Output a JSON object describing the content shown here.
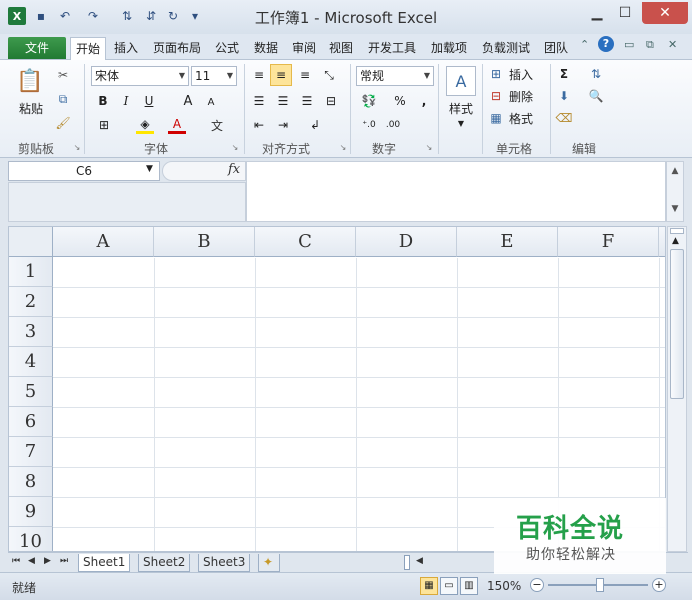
{
  "window": {
    "title": "工作簿1 - Microsoft Excel",
    "minimize": "▁",
    "maximize": "☐",
    "close": "✕"
  },
  "quick_access": [
    "💾",
    "↶",
    "↷",
    "⋮",
    "▾"
  ],
  "ribbon_tabs": [
    "文件",
    "开始",
    "插入",
    "页面布局",
    "公式",
    "数据",
    "审阅",
    "视图",
    "开发工具",
    "加载项",
    "负载测试",
    "团队"
  ],
  "ribbon": {
    "clipboard": {
      "paste": "粘贴",
      "label": "剪贴板"
    },
    "font": {
      "name": "宋体",
      "size": "11",
      "bold": "B",
      "italic": "I",
      "underline": "U",
      "grow": "A",
      "shrink": "A",
      "label": "字体"
    },
    "alignment": {
      "label": "对齐方式"
    },
    "number": {
      "format": "常规",
      "percent": "%",
      "comma": ",",
      "label": "数字"
    },
    "styles": {
      "label": "样式"
    },
    "cells": {
      "insert": "插入",
      "delete": "删除",
      "format": "格式",
      "label": "单元格"
    },
    "editing": {
      "sum": "Σ",
      "label": "编辑"
    }
  },
  "formula_bar": {
    "name_box": "C6",
    "fx": "fx",
    "value": ""
  },
  "grid": {
    "columns": [
      "A",
      "B",
      "C",
      "D",
      "E",
      "F"
    ],
    "rows": [
      "1",
      "2",
      "3",
      "4",
      "5",
      "6",
      "7",
      "8",
      "9",
      "10"
    ]
  },
  "sheets": [
    "Sheet1",
    "Sheet2",
    "Sheet3"
  ],
  "status": {
    "text": "就绪",
    "zoom": "150%"
  },
  "watermark": {
    "title": "百科全说",
    "subtitle": "助你轻松解决"
  },
  "colors": {
    "file_tab": "#217a33",
    "watermark": "#25a04a",
    "close": "#c9514c"
  }
}
